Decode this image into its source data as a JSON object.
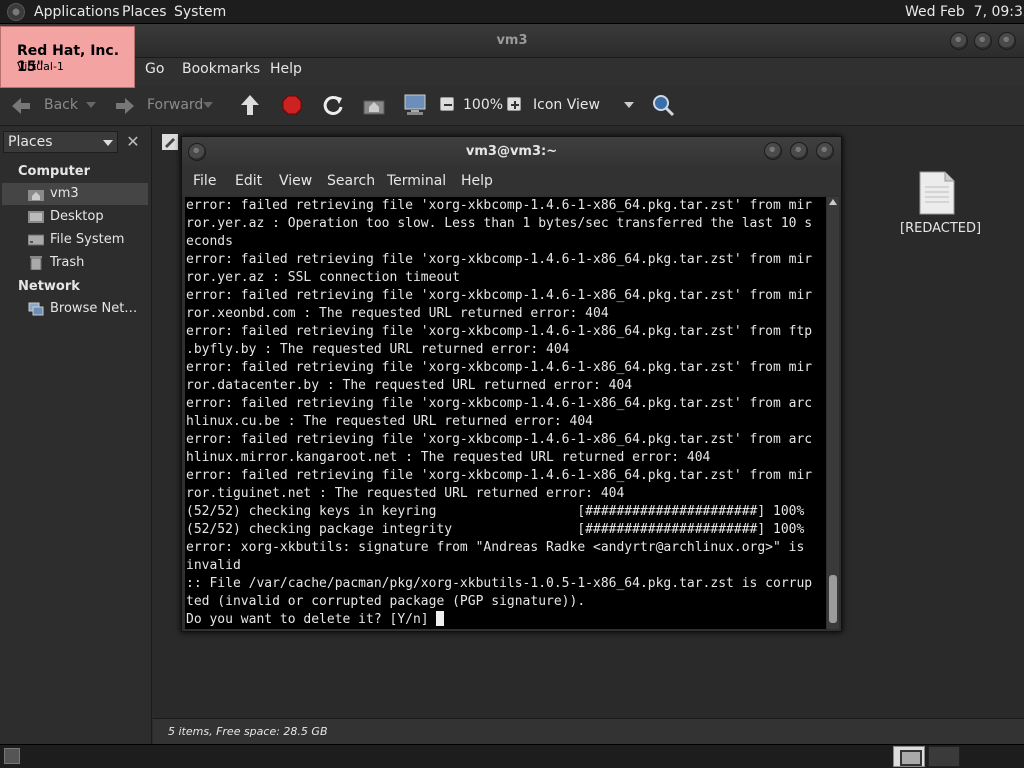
{
  "top_panel": {
    "menus": [
      "Applications",
      "Places",
      "System"
    ],
    "clock": "Wed Feb  7, 09:32"
  },
  "file_manager": {
    "title": "vm3",
    "menus": [
      "Go",
      "Bookmarks",
      "Help"
    ],
    "toolbar": {
      "back": "Back",
      "forward": "Forward",
      "zoom": "100%",
      "view_mode": "Icon View"
    },
    "sidebar": {
      "places_label": "Places",
      "computer_header": "Computer",
      "computer_items": [
        "vm3",
        "Desktop",
        "File System",
        "Trash"
      ],
      "network_header": "Network",
      "network_items": [
        "Browse Net…"
      ]
    },
    "files": [
      {
        "name": "[REDACTED]",
        "icon": "text-file-icon"
      }
    ],
    "status": "5 items, Free space: 28.5 GB"
  },
  "tooltip": {
    "title": "Red Hat, Inc. 15\"",
    "subtitle": "Virtual-1"
  },
  "terminal": {
    "title": "vm3@vm3:~",
    "menus": [
      "File",
      "Edit",
      "View",
      "Search",
      "Terminal",
      "Help"
    ],
    "lines": [
      "error: failed retrieving file 'xorg-xkbcomp-1.4.6-1-x86_64.pkg.tar.zst' from mir",
      "ror.yer.az : Operation too slow. Less than 1 bytes/sec transferred the last 10 s",
      "econds",
      "error: failed retrieving file 'xorg-xkbcomp-1.4.6-1-x86_64.pkg.tar.zst' from mir",
      "ror.yer.az : SSL connection timeout",
      "error: failed retrieving file 'xorg-xkbcomp-1.4.6-1-x86_64.pkg.tar.zst' from mir",
      "ror.xeonbd.com : The requested URL returned error: 404",
      "error: failed retrieving file 'xorg-xkbcomp-1.4.6-1-x86_64.pkg.tar.zst' from ftp",
      ".byfly.by : The requested URL returned error: 404",
      "error: failed retrieving file 'xorg-xkbcomp-1.4.6-1-x86_64.pkg.tar.zst' from mir",
      "ror.datacenter.by : The requested URL returned error: 404",
      "error: failed retrieving file 'xorg-xkbcomp-1.4.6-1-x86_64.pkg.tar.zst' from arc",
      "hlinux.cu.be : The requested URL returned error: 404",
      "error: failed retrieving file 'xorg-xkbcomp-1.4.6-1-x86_64.pkg.tar.zst' from arc",
      "hlinux.mirror.kangaroot.net : The requested URL returned error: 404",
      "error: failed retrieving file 'xorg-xkbcomp-1.4.6-1-x86_64.pkg.tar.zst' from mir",
      "ror.tiguinet.net : The requested URL returned error: 404",
      "(52/52) checking keys in keyring                  [######################] 100%",
      "(52/52) checking package integrity                [######################] 100%",
      "error: xorg-xkbutils: signature from \"Andreas Radke <andyrtr@archlinux.org>\" is",
      "invalid",
      ":: File /var/cache/pacman/pkg/xorg-xkbutils-1.0.5-1-x86_64.pkg.tar.zst is corrup",
      "ted (invalid or corrupted package (PGP signature)).",
      "Do you want to delete it? [Y/n] "
    ]
  }
}
